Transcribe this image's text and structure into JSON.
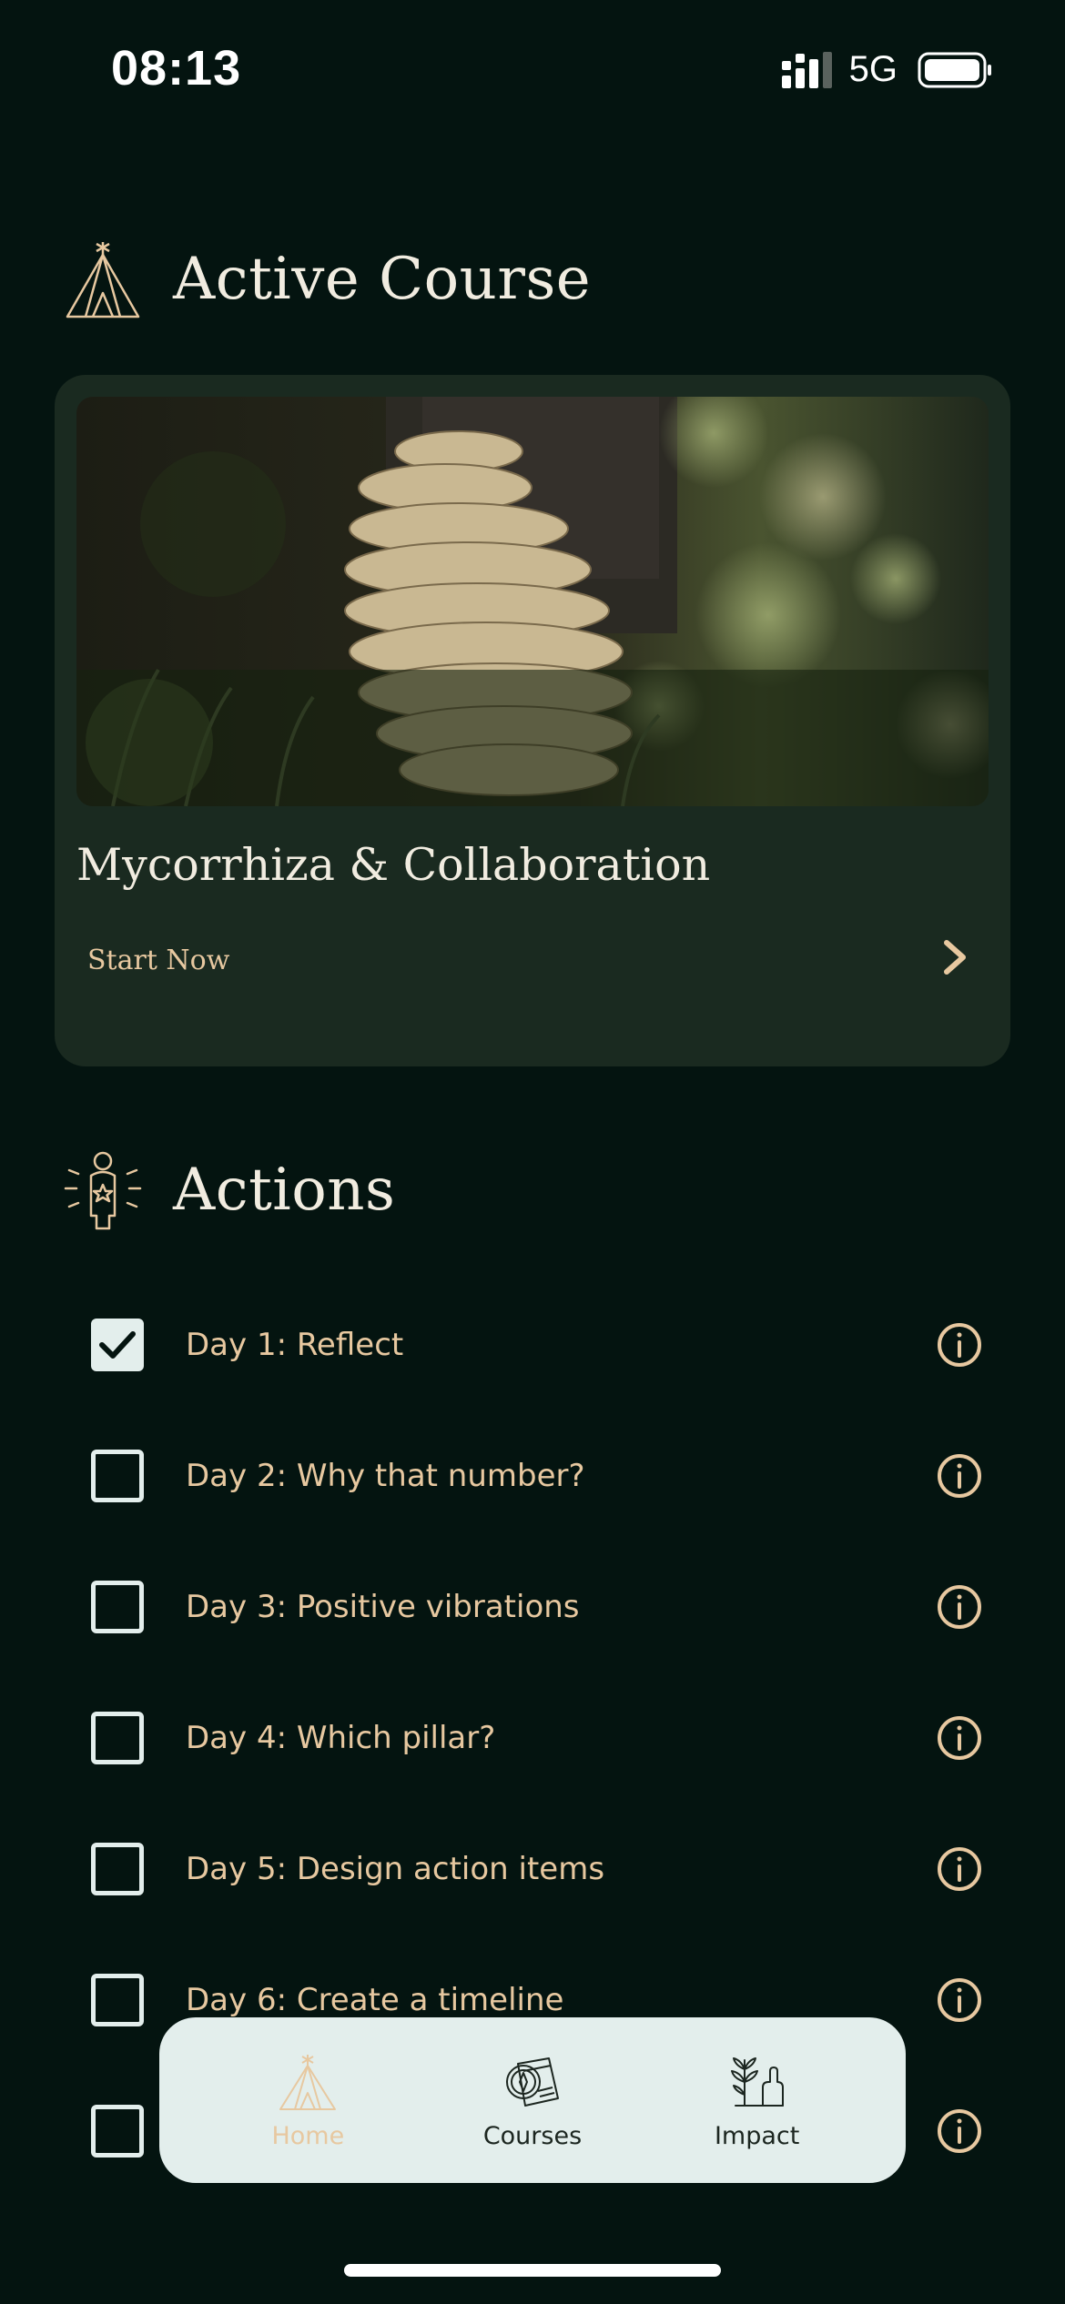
{
  "status_bar": {
    "time": "08:13",
    "network": "5G",
    "icons": [
      "signal-icon",
      "battery-icon"
    ]
  },
  "active_course": {
    "heading": "Active Course",
    "icon": "tipi-icon",
    "course_title": "Mycorrhiza & Collaboration",
    "cta_label": "Start Now",
    "image": "mushroom-photo"
  },
  "actions": {
    "heading": "Actions",
    "icon": "person-star-icon",
    "items": [
      {
        "label": "Day 1: Reflect",
        "checked": true
      },
      {
        "label": "Day 2: Why that number?",
        "checked": false
      },
      {
        "label": "Day 3: Positive vibrations",
        "checked": false
      },
      {
        "label": "Day 4: Which pillar?",
        "checked": false
      },
      {
        "label": "Day 5: Design action items",
        "checked": false
      },
      {
        "label": "Day 6: Create a timeline",
        "checked": false
      },
      {
        "label": "",
        "checked": false
      }
    ]
  },
  "bottom_nav": {
    "items": [
      {
        "label": "Home",
        "icon": "tipi-icon",
        "active": true
      },
      {
        "label": "Courses",
        "icon": "compass-map-icon",
        "active": false
      },
      {
        "label": "Impact",
        "icon": "plant-hand-icon",
        "active": false
      }
    ]
  },
  "colors": {
    "background": "#041410",
    "card": "#1a2a20",
    "accent": "#e7c8a0",
    "text": "#f1ece0",
    "nav_bg": "#e3eeec"
  }
}
